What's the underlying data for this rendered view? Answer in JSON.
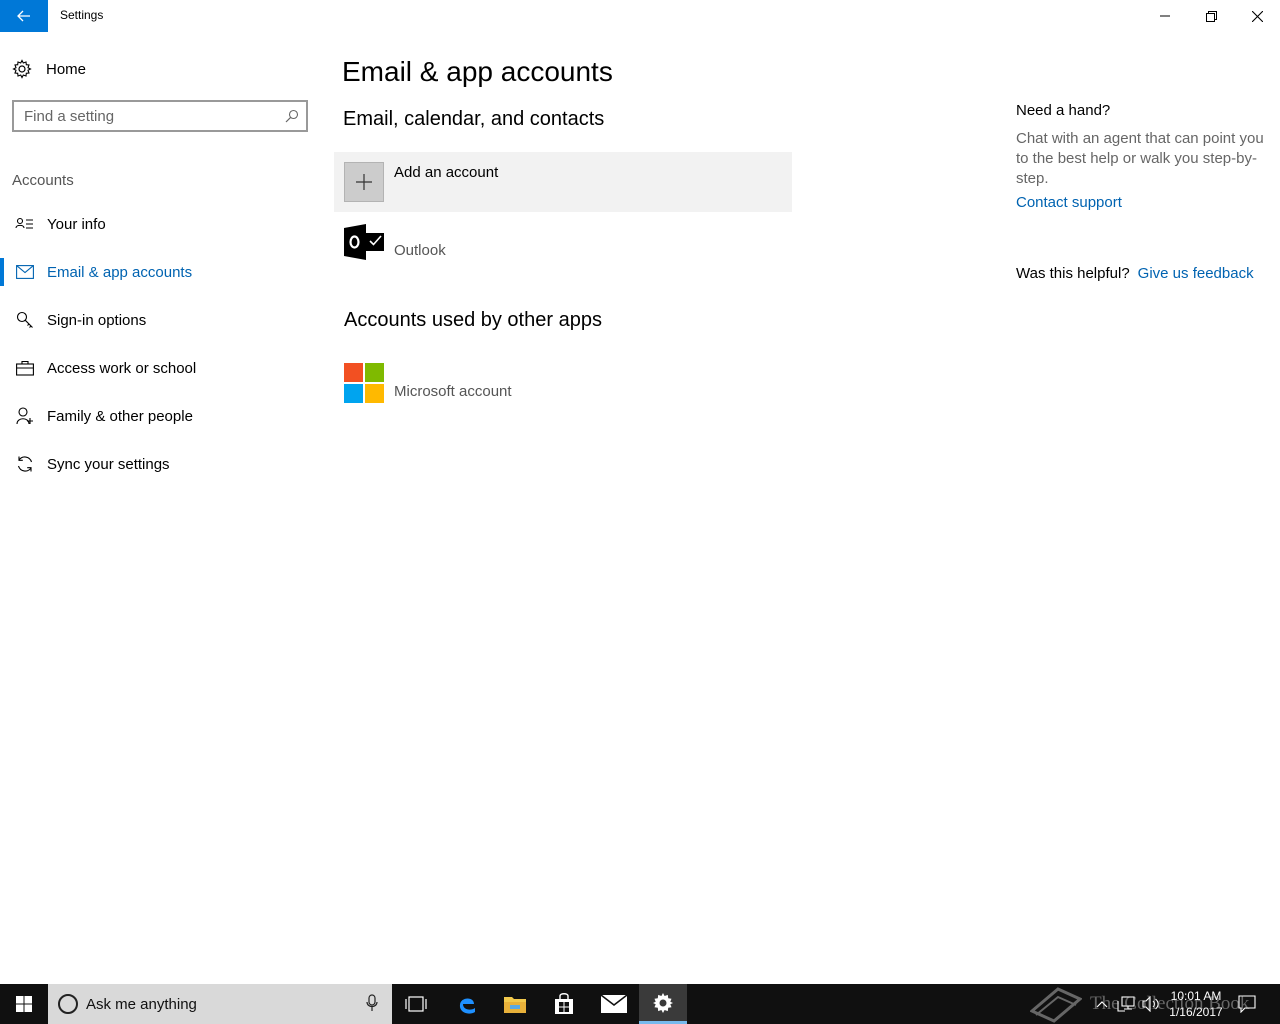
{
  "window": {
    "title": "Settings"
  },
  "sidebar": {
    "home_label": "Home",
    "search_placeholder": "Find a setting",
    "section_label": "Accounts",
    "items": [
      {
        "label": "Your info",
        "icon": "person-card-icon"
      },
      {
        "label": "Email & app accounts",
        "icon": "mail-icon",
        "active": true
      },
      {
        "label": "Sign-in options",
        "icon": "key-icon"
      },
      {
        "label": "Access work or school",
        "icon": "briefcase-icon"
      },
      {
        "label": "Family & other people",
        "icon": "person-add-icon"
      },
      {
        "label": "Sync your settings",
        "icon": "sync-icon"
      }
    ]
  },
  "main": {
    "title": "Email & app accounts",
    "section1_title": "Email, calendar, and contacts",
    "add_account_label": "Add an account",
    "outlook_label": "Outlook",
    "section2_title": "Accounts used by other apps",
    "microsoft_label": "Microsoft account"
  },
  "help": {
    "heading": "Need a hand?",
    "text": "Chat with an agent that can point you to the best help or walk you step-by-step.",
    "link": "Contact support",
    "helpful_question": "Was this helpful?",
    "feedback_link": "Give us feedback"
  },
  "taskbar": {
    "search_text": "Ask me anything",
    "time": "10:01 AM",
    "date": "1/16/2017",
    "watermark": "The Collection Book"
  },
  "colors": {
    "accent": "#0078d7",
    "link": "#0063b1",
    "ms_red": "#f25022",
    "ms_green": "#7fba00",
    "ms_blue": "#00a4ef",
    "ms_yellow": "#ffb900"
  }
}
